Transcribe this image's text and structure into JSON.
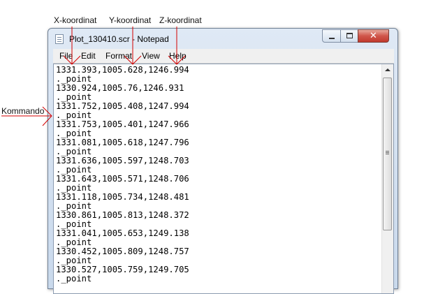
{
  "annotations": {
    "x_label": "X-koordinat",
    "y_label": "Y-koordinat",
    "z_label": "Z-koordinat",
    "command_label": "Kommando",
    "pointer_color": "#d40000"
  },
  "window": {
    "title": "Plot_130410.scr - Notepad",
    "icon": "notepad-icon",
    "controls": [
      "minimize-icon",
      "maximize-icon",
      "close-icon"
    ]
  },
  "menu": {
    "file": "File",
    "edit": "Edit",
    "format": "Format",
    "view": "View",
    "help": "Help"
  },
  "editor": {
    "lines": [
      "1331.393,1005.628,1246.994",
      "._point",
      "1330.924,1005.76,1246.931",
      "._point",
      "1331.752,1005.408,1247.994",
      "._point",
      "1331.753,1005.401,1247.966",
      "._point",
      "1331.081,1005.618,1247.796",
      "._point",
      "1331.636,1005.597,1248.703",
      "._point",
      "1331.643,1005.571,1248.706",
      "._point",
      "1331.118,1005.734,1248.481",
      "._point",
      "1330.861,1005.813,1248.372",
      "._point",
      "1331.041,1005.653,1249.138",
      "._point",
      "1330.452,1005.809,1248.757",
      "._point",
      "1330.527,1005.759,1249.705",
      "._point"
    ]
  }
}
